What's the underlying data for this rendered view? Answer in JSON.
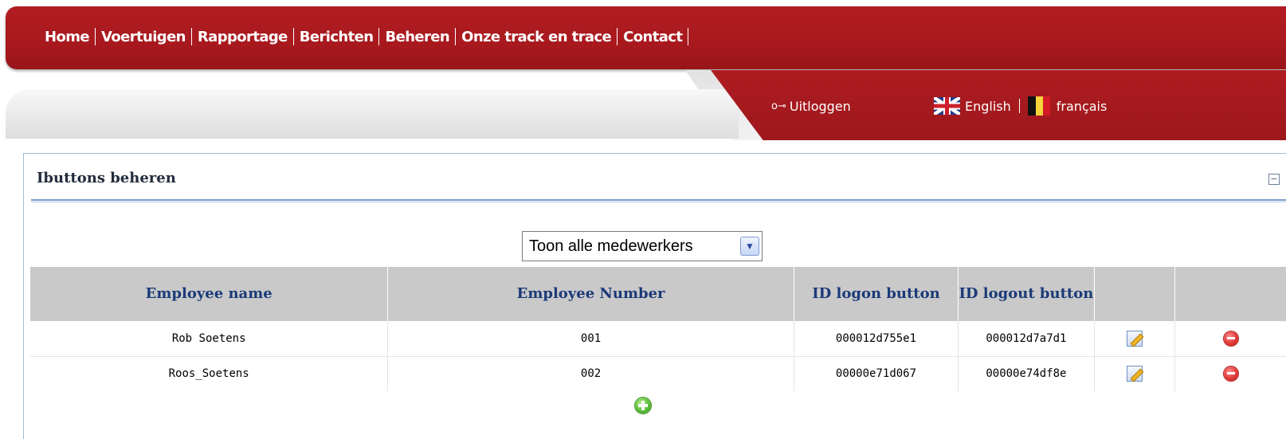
{
  "nav": {
    "items": [
      {
        "label": "Home"
      },
      {
        "label": "Voertuigen"
      },
      {
        "label": "Rapportage"
      },
      {
        "label": "Berichten"
      },
      {
        "label": "Beheren"
      },
      {
        "label": "Onze track en trace"
      },
      {
        "label": "Contact"
      }
    ]
  },
  "header": {
    "logout_icon": "key-icon",
    "logout_label": "Uitloggen",
    "languages": [
      {
        "label": "English",
        "icon": "uk-flag-icon"
      },
      {
        "label": "français",
        "icon": "belgium-flag-icon"
      }
    ]
  },
  "panel": {
    "title": "Ibuttons beheren",
    "filter": {
      "selected": "Toon alle medewerkers"
    }
  },
  "table": {
    "columns": [
      {
        "label": "Employee name"
      },
      {
        "label": "Employee Number"
      },
      {
        "label": "ID logon button"
      },
      {
        "label": "ID logout button"
      },
      {
        "label": ""
      },
      {
        "label": ""
      }
    ],
    "rows": [
      {
        "name": "Rob Soetens",
        "number": "001",
        "logon": "000012d755e1",
        "logout": "000012d7a7d1"
      },
      {
        "name": "Roos_Soetens",
        "number": "002",
        "logon": "00000e71d067",
        "logout": "00000e74df8e"
      }
    ]
  },
  "colors": {
    "brand_red": "#a8191e",
    "header_text": "#1b3a78",
    "panel_border": "#a7b9d3"
  }
}
